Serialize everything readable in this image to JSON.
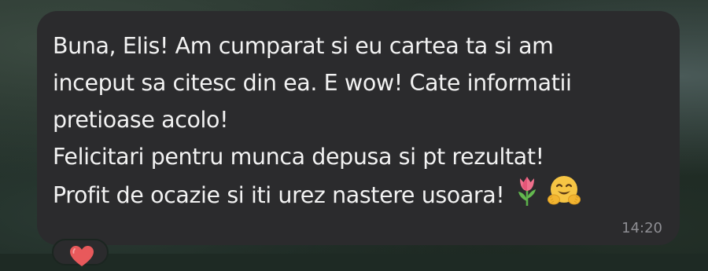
{
  "message": {
    "lines": [
      "Buna, Elis! Am cumparat si eu cartea ta si am",
      "inceput sa citesc din ea. E wow! Cate informatii",
      "pretioase acolo!",
      "Felicitari pentru munca depusa si pt rezultat!",
      "Profit de ocazie si iti urez nastere usoara!"
    ],
    "emojis": [
      "tulip-emoji",
      "hugging-face-emoji"
    ],
    "time": "14:20"
  },
  "reaction": {
    "icon": "heart-icon"
  },
  "colors": {
    "bubble": "#2b2b2d",
    "text": "#f2f2f2",
    "timestamp": "#8e8e93",
    "heart": "#e8595b"
  }
}
